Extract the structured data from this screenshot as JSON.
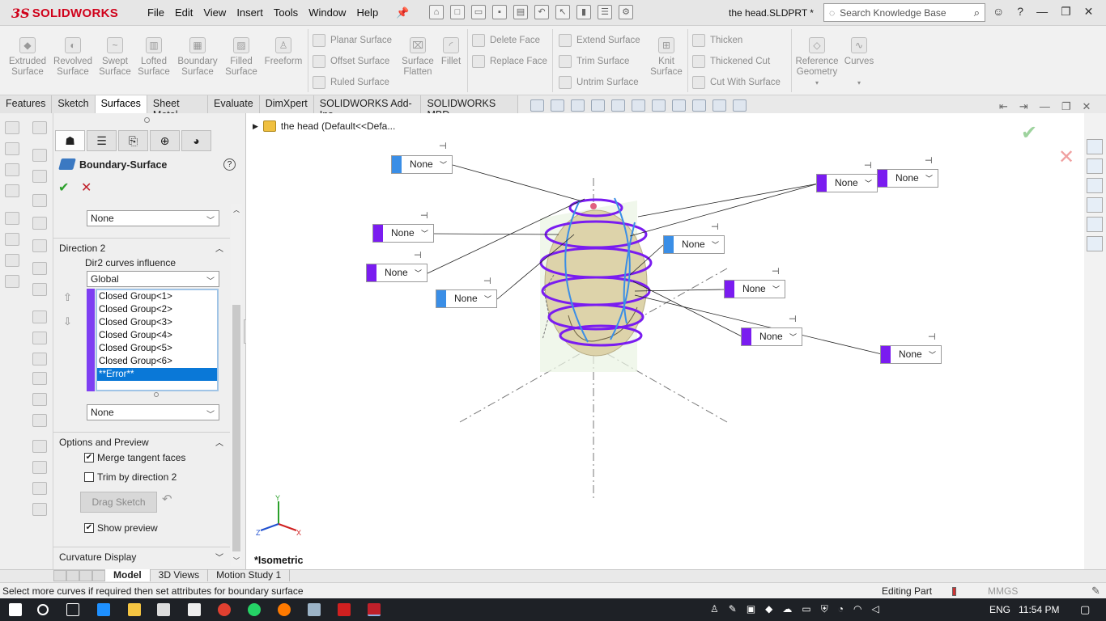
{
  "app": {
    "brand_ds": "3S",
    "brand_name": "SOLIDWORKS",
    "doc_title": "the head.SLDPRT *"
  },
  "menu": [
    "File",
    "Edit",
    "View",
    "Insert",
    "Tools",
    "Window",
    "Help"
  ],
  "search": {
    "placeholder": "Search Knowledge Base"
  },
  "ribbon": {
    "big_buttons": [
      "Extruded Surface",
      "Revolved Surface",
      "Swept Surface",
      "Lofted Surface",
      "Boundary Surface",
      "Filled Surface",
      "Freeform"
    ],
    "small_col1": [
      "Planar Surface",
      "Offset Surface",
      "Ruled Surface"
    ],
    "mid_buttons": [
      "Surface Flatten",
      "Fillet"
    ],
    "small_col2": [
      "Delete Face",
      "Replace Face"
    ],
    "small_col3": [
      "Extend Surface",
      "Trim Surface",
      "Untrim Surface"
    ],
    "knit": "Knit Surface",
    "small_col4": [
      "Thicken",
      "Thickened Cut",
      "Cut With Surface"
    ],
    "ref_geom": "Reference Geometry",
    "curves": "Curves"
  },
  "tabs": [
    "Features",
    "Sketch",
    "Surfaces",
    "Sheet Metal",
    "Evaluate",
    "DimXpert",
    "SOLIDWORKS Add-Ins",
    "SOLIDWORKS MBD"
  ],
  "active_tab": "Surfaces",
  "property_manager": {
    "title": "Boundary-Surface",
    "help": "?",
    "top_combo": "None",
    "direction2": {
      "label": "Direction 2",
      "influence_label": "Dir2 curves influence",
      "influence_value": "Global",
      "curves": [
        "Closed Group<1>",
        "Closed Group<2>",
        "Closed Group<3>",
        "Closed Group<4>",
        "Closed Group<5>",
        "Closed Group<6>",
        "**Error**"
      ],
      "selected_index": 6,
      "bottom_combo": "None"
    },
    "options": {
      "label": "Options and Preview",
      "merge_tangent": "Merge tangent faces",
      "merge_checked": true,
      "trim_dir2": "Trim by direction 2",
      "trim_checked": false,
      "drag_sketch": "Drag Sketch",
      "show_preview": "Show preview",
      "preview_checked": true
    },
    "curvature_label": "Curvature Display"
  },
  "viewport": {
    "tree_label": "the head  (Default<<Defa...",
    "view_name": "*Isometric",
    "tags": [
      {
        "label": "None",
        "color": "#3a8ee6"
      },
      {
        "label": "None",
        "color": "#7a1cf0"
      },
      {
        "label": "None",
        "color": "#7a1cf0"
      },
      {
        "label": "None",
        "color": "#3a8ee6"
      },
      {
        "label": "None",
        "color": "#7a1cf0"
      },
      {
        "label": "None",
        "color": "#7a1cf0"
      },
      {
        "label": "None",
        "color": "#3a8ee6"
      },
      {
        "label": "None",
        "color": "#7a1cf0"
      },
      {
        "label": "None",
        "color": "#7a1cf0"
      },
      {
        "label": "None",
        "color": "#7a1cf0"
      }
    ],
    "triad": {
      "x": "X",
      "y": "Y",
      "z": "Z"
    }
  },
  "bottom_tabs": [
    "Model",
    "3D Views",
    "Motion Study 1"
  ],
  "status": {
    "message": "Select more curves if required then set attributes for boundary surface",
    "editing": "Editing Part",
    "units": "MMGS"
  },
  "taskbar": {
    "lang": "ENG",
    "time": "11:54 PM"
  }
}
